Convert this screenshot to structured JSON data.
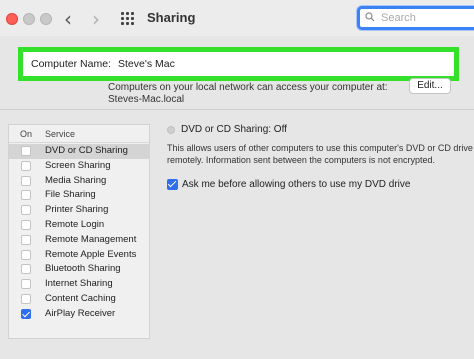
{
  "window": {
    "title": "Sharing",
    "search_placeholder": "Search"
  },
  "computer_name": {
    "label": "Computer Name:",
    "value": "Steve's Mac"
  },
  "info": {
    "line1": "Computers on your local network can access your computer at:",
    "line2": "Steves-Mac.local",
    "edit_label": "Edit..."
  },
  "service_list": {
    "col_on": "On",
    "col_service": "Service",
    "items": [
      {
        "label": "DVD or CD Sharing",
        "checked": false,
        "selected": true
      },
      {
        "label": "Screen Sharing",
        "checked": false,
        "selected": false
      },
      {
        "label": "Media Sharing",
        "checked": false,
        "selected": false
      },
      {
        "label": "File Sharing",
        "checked": false,
        "selected": false
      },
      {
        "label": "Printer Sharing",
        "checked": false,
        "selected": false
      },
      {
        "label": "Remote Login",
        "checked": false,
        "selected": false
      },
      {
        "label": "Remote Management",
        "checked": false,
        "selected": false
      },
      {
        "label": "Remote Apple Events",
        "checked": false,
        "selected": false
      },
      {
        "label": "Bluetooth Sharing",
        "checked": false,
        "selected": false
      },
      {
        "label": "Internet Sharing",
        "checked": false,
        "selected": false
      },
      {
        "label": "Content Caching",
        "checked": false,
        "selected": false
      },
      {
        "label": "AirPlay Receiver",
        "checked": true,
        "selected": false
      }
    ]
  },
  "detail": {
    "status": "DVD or CD Sharing: Off",
    "desc1": "This allows users of other computers to use this computer's DVD or CD drive",
    "desc2": "remotely. Information sent between the computers is not encrypted.",
    "ask_label": "Ask me before allowing others to use my DVD drive",
    "ask_checked": true
  },
  "colors": {
    "highlight": "#33e02a",
    "accent": "#2e6ff0",
    "close": "#fe5f57"
  }
}
